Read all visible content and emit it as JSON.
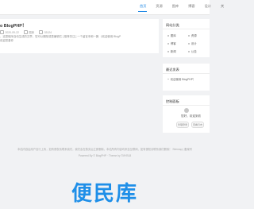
{
  "nav": {
    "items": [
      "首页",
      "资源",
      "图库",
      "博客",
      "设计",
      "关"
    ],
    "active": "首页"
  },
  "post": {
    "title": "o BlogPHP！",
    "meta": {
      "date": "2020-09-22",
      "category": "图库",
      "views": "33124"
    },
    "excerpt": [
      "，这是程序自动生成的文章，您可以删除或是编辑它 [ 推荐关注 ] 一个留言本和一篇 《欢迎使用 BlogP",
      "欢迎您爱你"
    ]
  },
  "sidebar": {
    "categories": {
      "title": "网站分类",
      "items": [
        "图库",
        "资源",
        "博客",
        "设计",
        "新闻",
        "公告"
      ]
    },
    "recent": {
      "title": "最近发表",
      "items": [
        "欢迎使用 BlogPHP！"
      ]
    },
    "control": {
      "title": "控制面板",
      "greeting": "您好，欢迎到访",
      "buttons": [
        "管理登录",
        "查看日志"
      ]
    }
  },
  "footer": {
    "line1": "本站内容由用户自行上传，如有侵权请联系我们，我们会在核实后立即删除。本站所有内容均来自互联网，如有侵权请联系我们删除！ Sitemap | 备案号",
    "line2": "Powered By © BlogPHP · Theme by TMYB18"
  },
  "watermark": "便民库",
  "colors": {
    "accent": "#1e88e5",
    "background": "#f1f2f4",
    "card": "#ffffff",
    "watermark": "#1f8fe8"
  }
}
